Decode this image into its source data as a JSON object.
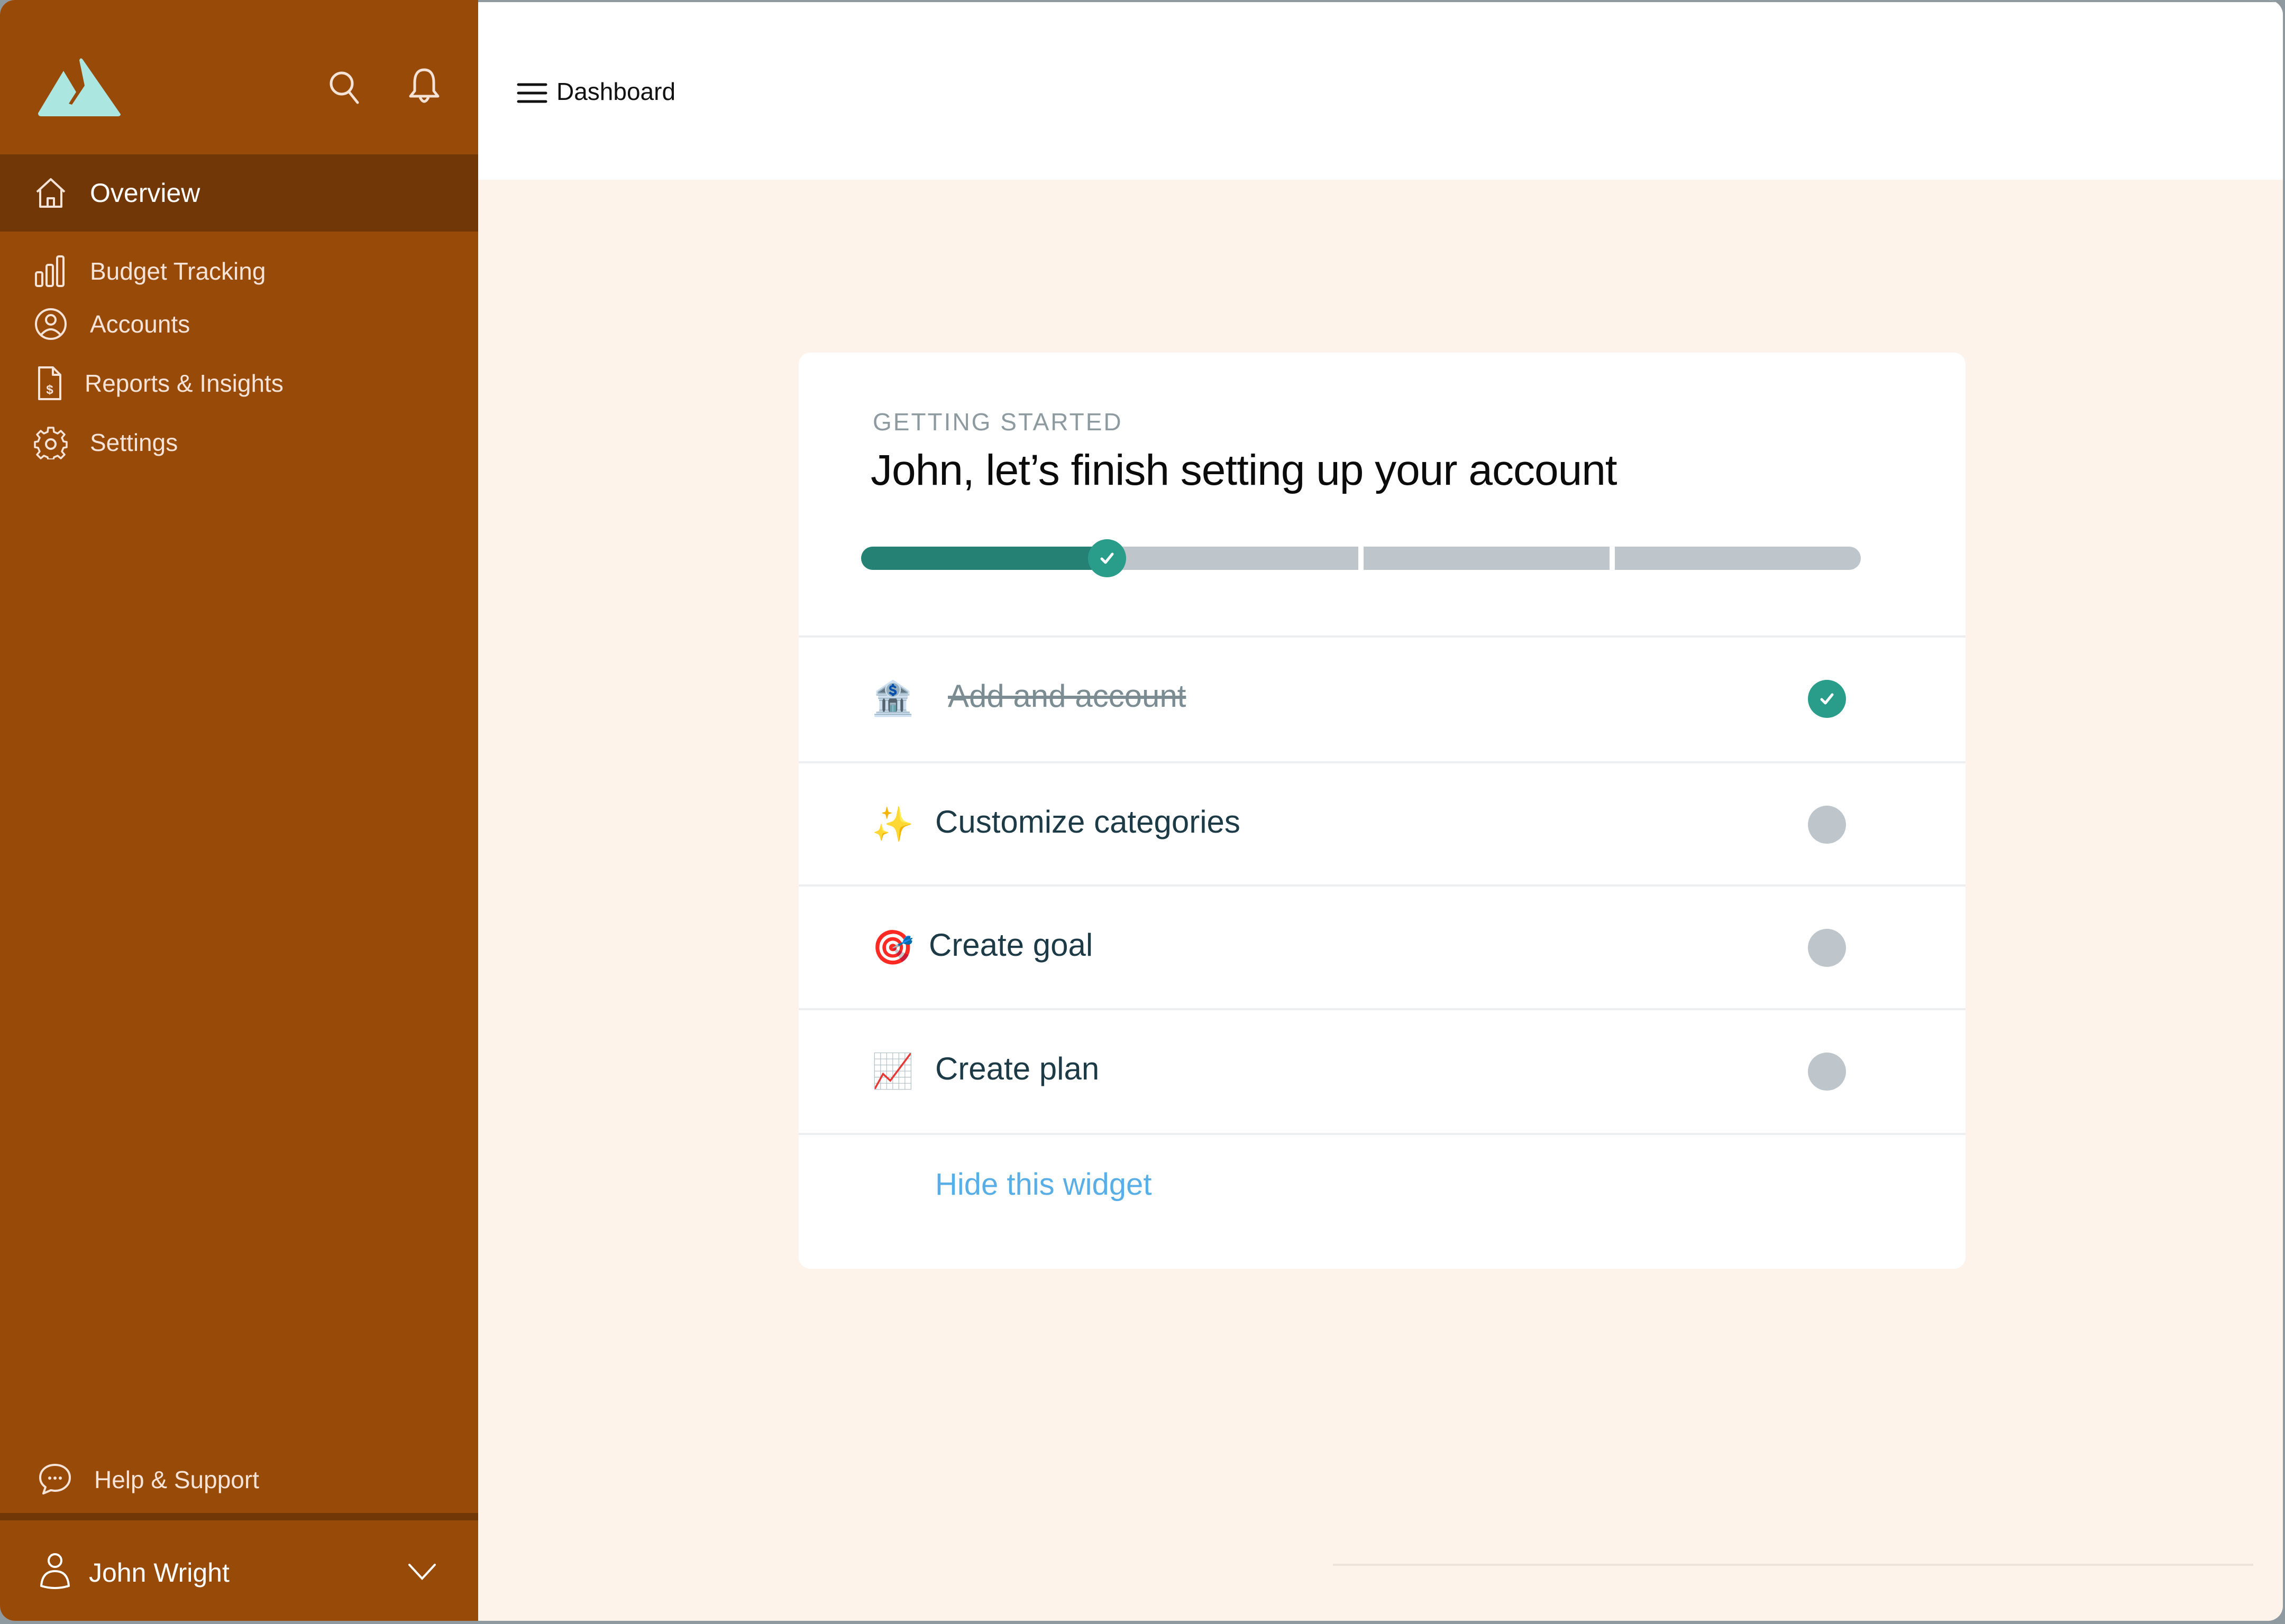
{
  "app": {
    "brand_icon": "mountain-logo-icon",
    "colors": {
      "sidebar_bg": "#984a09",
      "sidebar_active_bg": "#713707",
      "page_bg": "#fdf3eb",
      "accent_teal": "#2a9d8a",
      "progress_done": "#248174",
      "progress_pending": "#bec6cc",
      "link": "#59aee6",
      "logo": "#abe6e0"
    }
  },
  "sidebar": {
    "top_icons": [
      {
        "name": "search-icon"
      },
      {
        "name": "bell-icon"
      }
    ],
    "items": [
      {
        "label": "Overview",
        "icon": "home-icon",
        "active": true
      },
      {
        "label": "Budget Tracking",
        "icon": "bar-chart-icon",
        "active": false
      },
      {
        "label": "Accounts",
        "icon": "user-circle-icon",
        "active": false
      },
      {
        "label": "Reports & Insights",
        "icon": "dollar-document-icon",
        "active": false
      },
      {
        "label": "Settings",
        "icon": "gear-icon",
        "active": false
      }
    ],
    "help": {
      "label": "Help & Support",
      "icon": "chat-bubble-icon"
    },
    "user": {
      "name": "John Wright",
      "icon": "user-icon",
      "menu_icon": "chevron-down-icon"
    }
  },
  "header": {
    "menu_icon": "hamburger-icon",
    "title": "Dashboard"
  },
  "widget": {
    "eyebrow": "GETTING STARTED",
    "title": "John, let’s finish setting up your account",
    "progress": {
      "completed_steps": 1,
      "total_steps": 4
    },
    "tasks": [
      {
        "label": "Add and account",
        "emoji": "🏦",
        "icon": "bank-icon",
        "done": true
      },
      {
        "label": "Customize categories",
        "emoji": "✨",
        "icon": "sparkles-icon",
        "done": false
      },
      {
        "label": "Create goal",
        "emoji": "🎯",
        "icon": "target-icon",
        "done": false
      },
      {
        "label": "Create plan",
        "emoji": "📈",
        "icon": "chart-increasing-icon",
        "done": false
      }
    ],
    "hide_link": "Hide this widget"
  }
}
